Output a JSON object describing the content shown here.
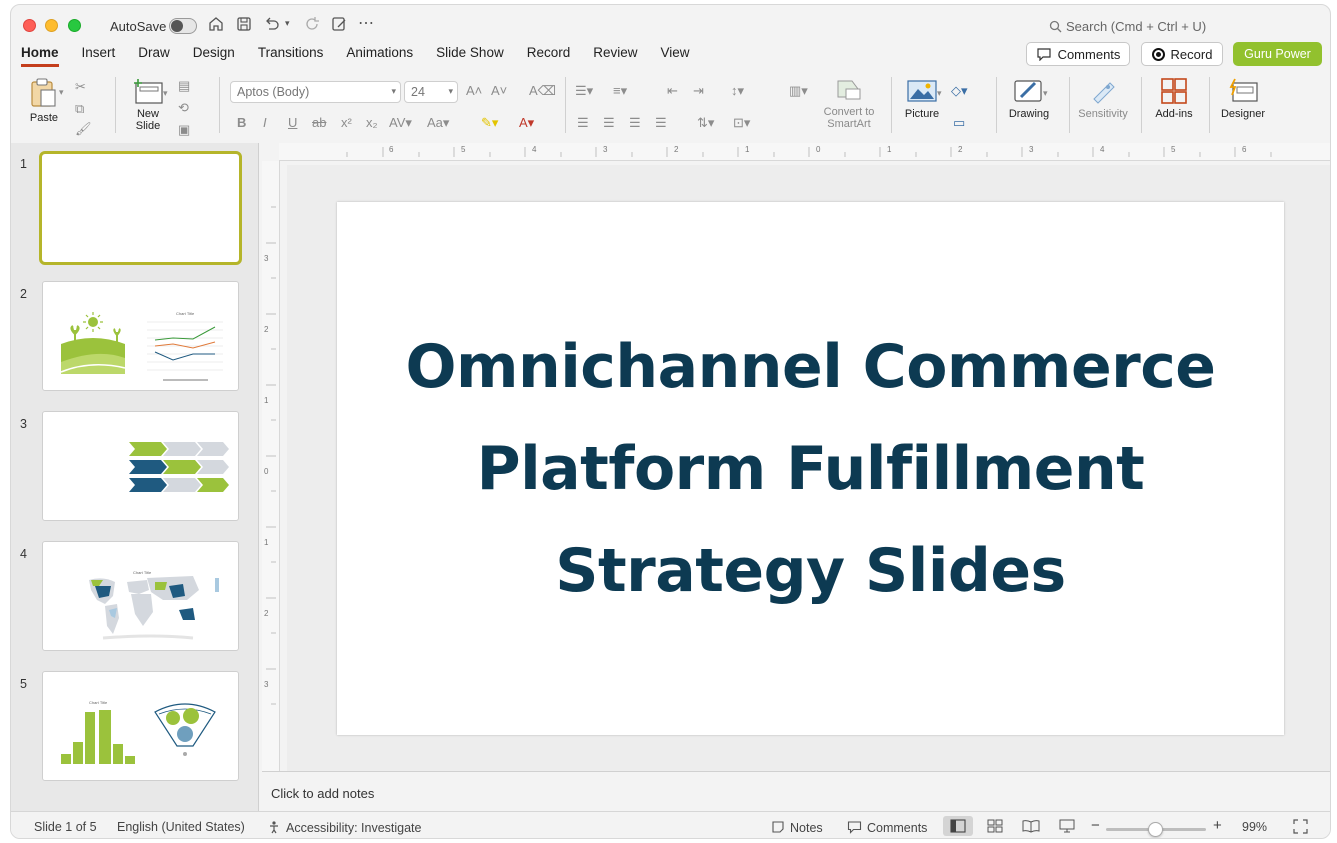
{
  "titlebar": {
    "autosave_label": "AutoSave",
    "autosave_on": false,
    "search_placeholder": "Search (Cmd + Ctrl + U)"
  },
  "tabs": [
    "Home",
    "Insert",
    "Draw",
    "Design",
    "Transitions",
    "Animations",
    "Slide Show",
    "Record",
    "Review",
    "View"
  ],
  "active_tab": "Home",
  "top_buttons": {
    "comments": "Comments",
    "record": "Record",
    "guru": "Guru Power"
  },
  "ribbon": {
    "paste": "Paste",
    "new_slide_1": "New",
    "new_slide_2": "Slide",
    "font_name": "Aptos (Body)",
    "font_size": "24",
    "smartart_1": "Convert to",
    "smartart_2": "SmartArt",
    "picture": "Picture",
    "drawing": "Drawing",
    "sensitivity": "Sensitivity",
    "addins": "Add-ins",
    "designer": "Designer"
  },
  "slides": [
    {
      "number": "1"
    },
    {
      "number": "2"
    },
    {
      "number": "3"
    },
    {
      "number": "4"
    },
    {
      "number": "5"
    }
  ],
  "current_slide": {
    "title_lines": [
      "Omnichannel Commerce",
      "Platform Fulfillment",
      "Strategy Slides"
    ]
  },
  "notes_placeholder": "Click to add notes",
  "status": {
    "slide_info": "Slide 1 of 5",
    "language": "English (United States)",
    "accessibility": "Accessibility: Investigate",
    "notes": "Notes",
    "comments": "Comments",
    "zoom": "99%"
  },
  "colors": {
    "accent_tab": "#c43e1c",
    "guru": "#92c12e",
    "title_text": "#0d3a52",
    "thumb_green": "#9bc23c",
    "thumb_navy": "#1f5a80"
  }
}
